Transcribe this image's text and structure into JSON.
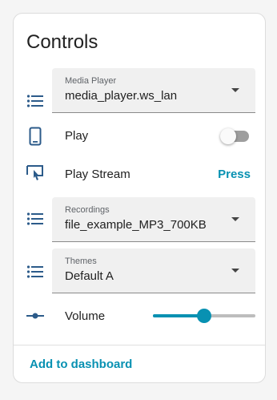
{
  "card": {
    "title": "Controls",
    "footer_action": "Add to dashboard"
  },
  "rows": {
    "media_player": {
      "label": "Media Player",
      "value": "media_player.ws_lan",
      "icon": "list-icon"
    },
    "play": {
      "label": "Play",
      "state": "off",
      "icon": "mobile-phone-icon"
    },
    "play_stream": {
      "label": "Play Stream",
      "action": "Press",
      "icon": "cast-tap-icon"
    },
    "recordings": {
      "label": "Recordings",
      "value": "file_example_MP3_700KB",
      "icon": "list-icon"
    },
    "themes": {
      "label": "Themes",
      "value": "Default A",
      "icon": "list-icon"
    },
    "volume": {
      "label": "Volume",
      "value_fraction": 0.5,
      "icon": "slider-icon"
    }
  },
  "colors": {
    "accent": "#0891b2",
    "icon": "#2c5b8a",
    "text": "#212121"
  }
}
